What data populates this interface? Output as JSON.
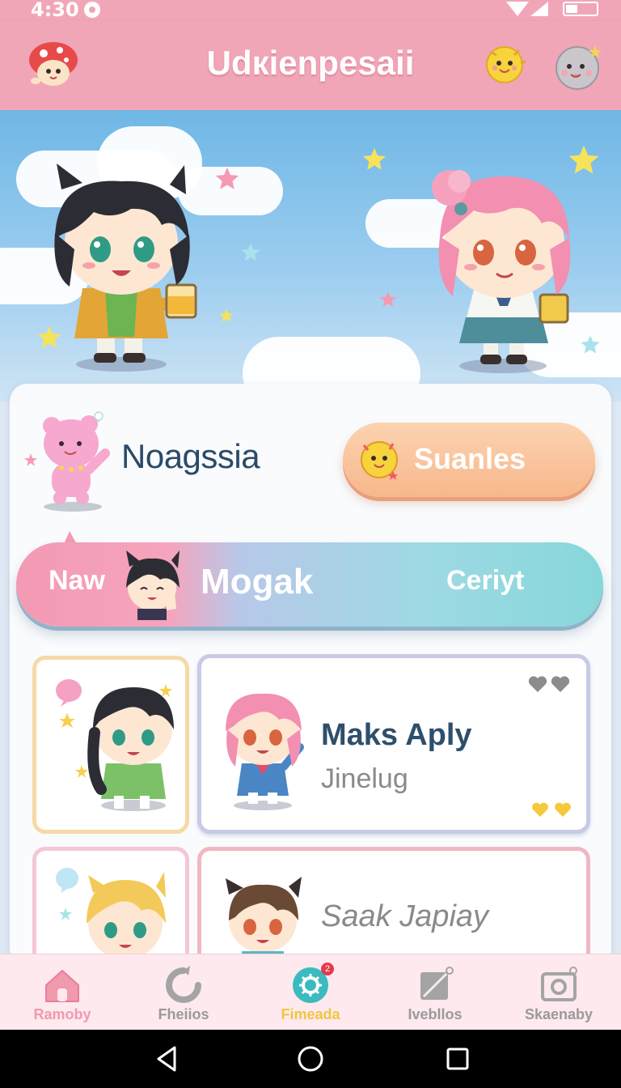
{
  "status_bar": {
    "time": "4:30"
  },
  "app_bar": {
    "title": "Udкienpesaii"
  },
  "profile": {
    "name": "Noagssia",
    "action_label": "Suanles"
  },
  "tabs": {
    "left": "Naw",
    "center": "Mogak",
    "right": "Ceriyt"
  },
  "cards": [
    {
      "title": "Maks Aply",
      "subtitle": "Jinelug"
    },
    {
      "title": "Saak Japiay"
    }
  ],
  "bottom_nav": {
    "items": [
      {
        "label": "Ramoby",
        "color": "#f199ad"
      },
      {
        "label": "Fheiios",
        "color": "#9a9a9a"
      },
      {
        "label": "Fimeada",
        "color": "#f1c542",
        "badge": "2"
      },
      {
        "label": "Ivebllos",
        "color": "#9a9a9a"
      },
      {
        "label": "Skaenaby",
        "color": "#9a9a9a"
      }
    ]
  },
  "colors": {
    "primary_pink": "#f1a6b8",
    "accent_teal": "#3bbac0",
    "sky_blue": "#6fb7e6"
  }
}
